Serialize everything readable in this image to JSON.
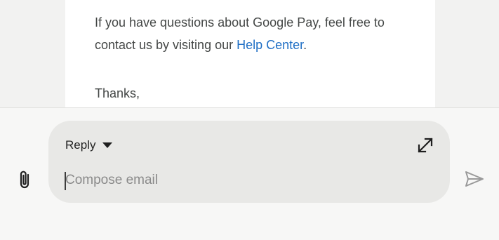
{
  "email": {
    "body_text": "If you have questions about Google Pay, feel free to contact us by visiting our ",
    "link_text": "Help Center",
    "body_suffix": ".",
    "closing": "Thanks,"
  },
  "compose": {
    "reply_label": "Reply",
    "placeholder": "Compose email",
    "value": ""
  },
  "icons": {
    "attach": "paperclip-icon",
    "reply_dropdown": "caret-down-icon",
    "expand": "expand-icon",
    "send": "send-icon"
  },
  "colors": {
    "link": "#1f6fc5",
    "compose_bg": "#e8e8e6",
    "send_disabled": "#9a9a9a"
  }
}
